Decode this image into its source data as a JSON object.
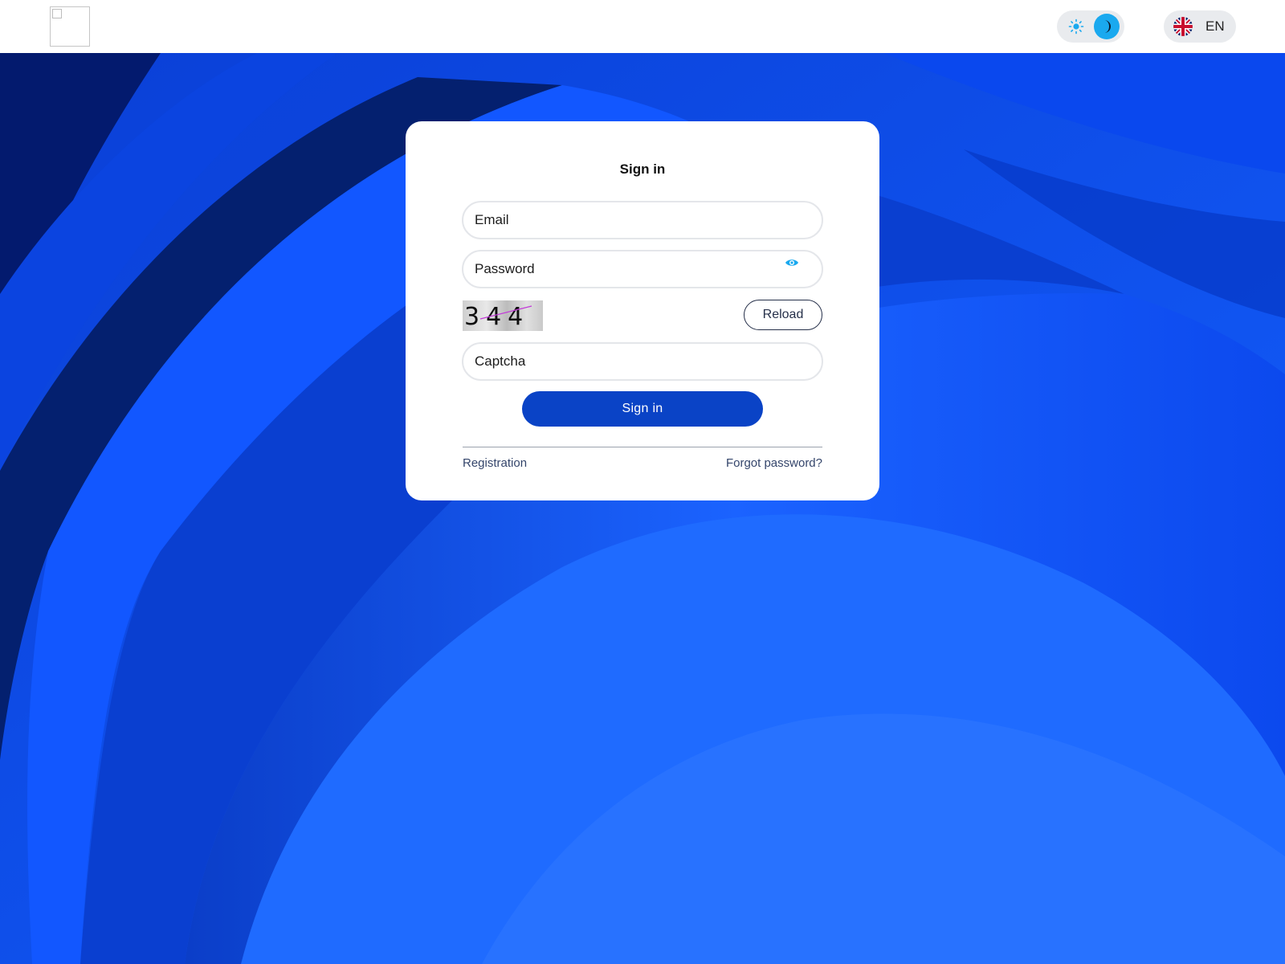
{
  "header": {
    "logo_icon": "broken-image-icon",
    "theme_toggle": {
      "light_icon": "sun-icon",
      "dark_icon": "moon-icon",
      "active": "dark",
      "accent": "#1aa9ef"
    },
    "language": {
      "flag_icon": "uk-flag-icon",
      "code": "EN"
    }
  },
  "background": {
    "color": "#0a4cf5",
    "style": "blue abstract waves"
  },
  "form": {
    "title": "Sign in",
    "email": {
      "placeholder": "Email",
      "value": ""
    },
    "password": {
      "placeholder": "Password",
      "value": "",
      "toggle_icon": "eye-icon"
    },
    "captcha_image_text": "344",
    "reload_label": "Reload",
    "captcha": {
      "placeholder": "Captcha",
      "value": ""
    },
    "submit_label": "Sign in",
    "submit_color": "#0a43c6",
    "registration_link": "Registration",
    "forgot_password_link": "Forgot password?"
  }
}
